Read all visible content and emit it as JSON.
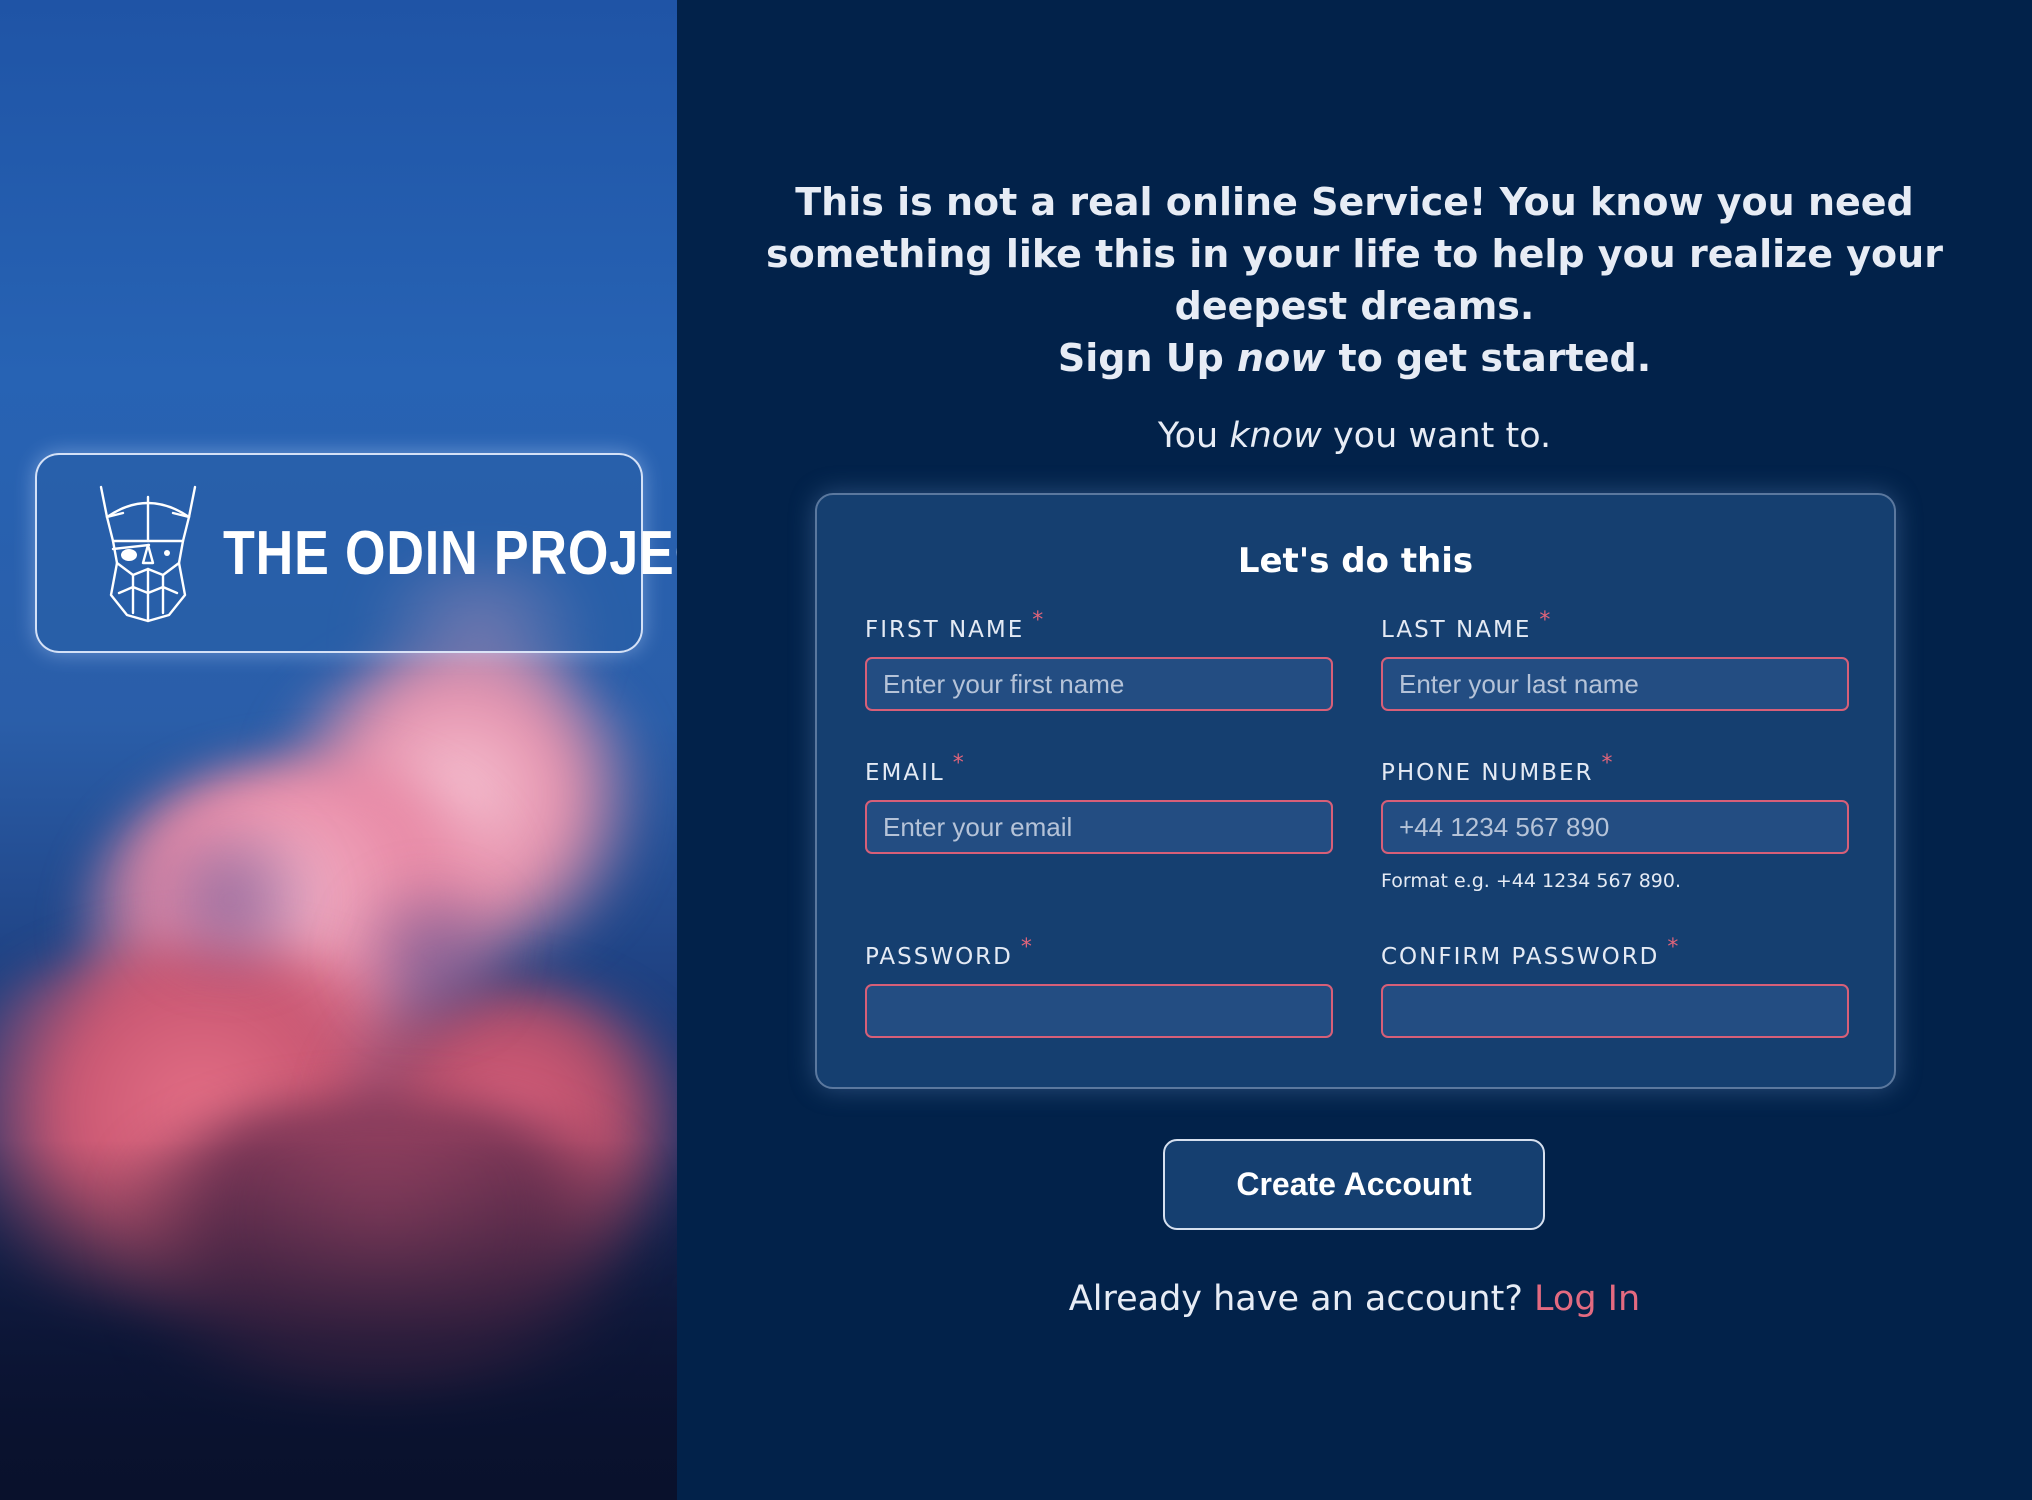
{
  "brand": {
    "name": "THE ODIN PROJECT"
  },
  "intro": {
    "line1": "This is not a real online Service! You know you need",
    "line2": "something like this in your life to help you realize your",
    "line3": "deepest dreams.",
    "signup_prefix": "Sign Up ",
    "signup_emphasis": "now",
    "signup_suffix": " to get started."
  },
  "subline": {
    "prefix": "You ",
    "emphasis": "know",
    "suffix": " you want to."
  },
  "form": {
    "title": "Let's do this",
    "required_mark": "*",
    "fields": {
      "first_name": {
        "label": "FIRST NAME",
        "placeholder": "Enter your first name",
        "value": ""
      },
      "last_name": {
        "label": "LAST NAME",
        "placeholder": "Enter your last name",
        "value": ""
      },
      "email": {
        "label": "EMAIL",
        "placeholder": "Enter your email",
        "value": ""
      },
      "phone": {
        "label": "PHONE NUMBER",
        "placeholder": "+44 1234 567 890",
        "value": "",
        "hint": "Format e.g. +44 1234 567 890."
      },
      "password": {
        "label": "PASSWORD",
        "placeholder": "",
        "value": ""
      },
      "confirm_password": {
        "label": "CONFIRM PASSWORD",
        "placeholder": "",
        "value": ""
      }
    }
  },
  "actions": {
    "create_account": "Create Account",
    "login_prompt": "Already have an account? ",
    "login_link": "Log In"
  },
  "colors": {
    "page_background": "#02224a",
    "form_background": "#153f70",
    "input_border": "#d75f78",
    "accent_link": "#e36a80"
  }
}
